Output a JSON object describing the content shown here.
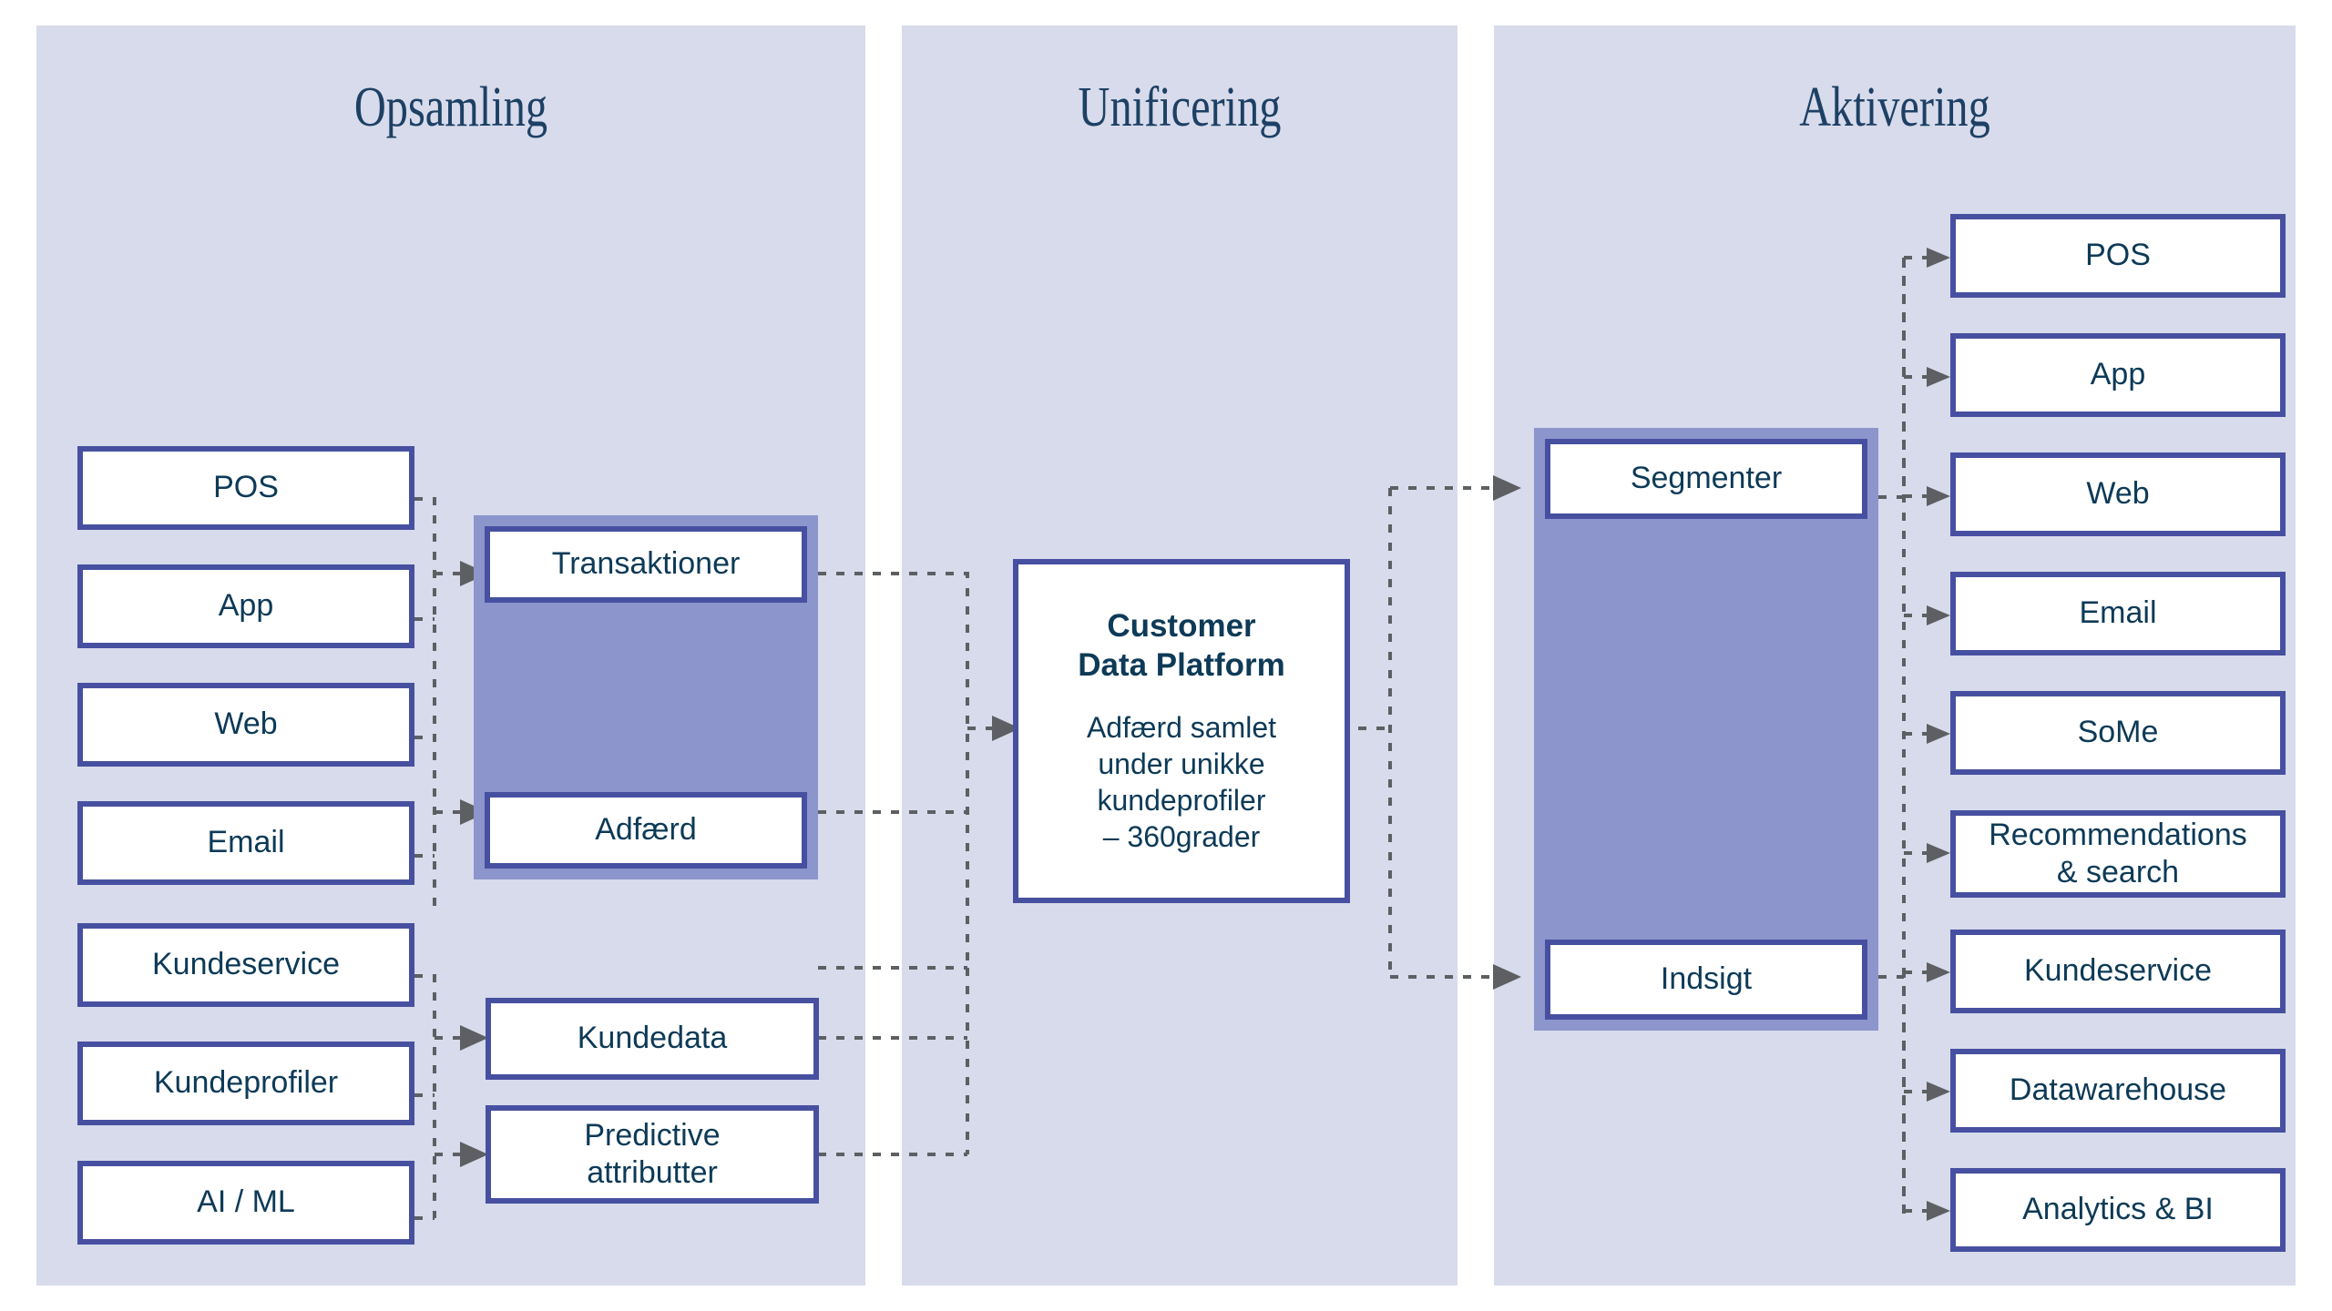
{
  "columns": [
    {
      "id": "opsamling",
      "title": "Opsamling"
    },
    {
      "id": "unificering",
      "title": "Unificering"
    },
    {
      "id": "aktivering",
      "title": "Aktivering"
    }
  ],
  "colors": {
    "panel_background": "#d7dbeb",
    "group_fill": "#8c95cc",
    "box_border": "#4750a0",
    "box_fill": "#ffffff",
    "text": "#0d3a57",
    "title_text": "#1d4064",
    "connector": "#5d5f63"
  },
  "opsamling": {
    "sources_top": [
      {
        "label": "POS"
      },
      {
        "label": "App"
      },
      {
        "label": "Web"
      },
      {
        "label": "Email"
      }
    ],
    "sources_bottom": [
      {
        "label": "Kundeservice"
      },
      {
        "label": "Kundeprofiler"
      },
      {
        "label": "AI / ML"
      }
    ],
    "data_group": [
      {
        "label": "Transaktioner"
      },
      {
        "label": "Adfærd"
      }
    ],
    "data_pair": [
      {
        "label": "Kundedata"
      },
      {
        "label": "Predictive attributter",
        "line1": "Predictive",
        "line2": "attributter"
      }
    ]
  },
  "unificering": {
    "platform": {
      "title_line1": "Customer",
      "title_line2": "Data Platform",
      "body_line1": "Adfærd samlet",
      "body_line2": "under unikke",
      "body_line3": "kundeprofiler",
      "body_line4": "– 360grader"
    }
  },
  "aktivering": {
    "group": [
      {
        "label": "Segmenter"
      },
      {
        "label": "Indsigt"
      }
    ],
    "channels": [
      {
        "label": "POS"
      },
      {
        "label": "App"
      },
      {
        "label": "Web"
      },
      {
        "label": "Email"
      },
      {
        "label": "SoMe"
      },
      {
        "label": "Recommendations & search",
        "line1": "Recommendations",
        "line2": "& search"
      },
      {
        "label": "Kundeservice"
      },
      {
        "label": "Datawarehouse"
      },
      {
        "label": "Analytics & BI"
      }
    ]
  }
}
